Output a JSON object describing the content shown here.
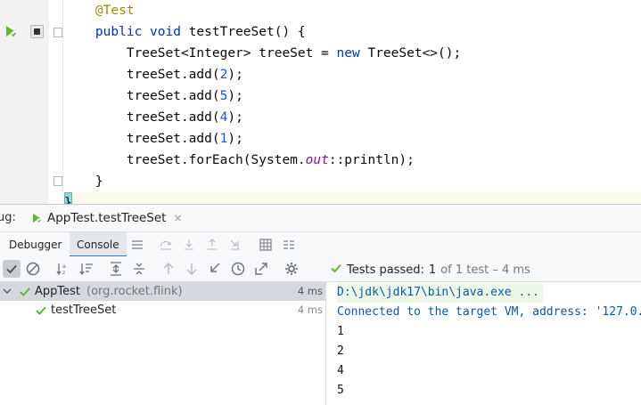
{
  "editor": {
    "lines": [
      {
        "ind": "    ",
        "segs": [
          {
            "t": "@Test",
            "c": "ann"
          }
        ]
      },
      {
        "ind": "    ",
        "segs": [
          {
            "t": "public ",
            "c": "kw"
          },
          {
            "t": "void ",
            "c": "kw"
          },
          {
            "t": "testTreeSet() {",
            "c": ""
          }
        ]
      },
      {
        "ind": "        ",
        "segs": [
          {
            "t": "TreeSet<Integer> treeSet = ",
            "c": ""
          },
          {
            "t": "new ",
            "c": "kw"
          },
          {
            "t": "TreeSet<>();",
            "c": ""
          }
        ]
      },
      {
        "ind": "        ",
        "segs": [
          {
            "t": "treeSet.add(",
            "c": ""
          },
          {
            "t": "2",
            "c": "num"
          },
          {
            "t": ");",
            "c": ""
          }
        ]
      },
      {
        "ind": "        ",
        "segs": [
          {
            "t": "treeSet.add(",
            "c": ""
          },
          {
            "t": "5",
            "c": "num"
          },
          {
            "t": ");",
            "c": ""
          }
        ]
      },
      {
        "ind": "        ",
        "segs": [
          {
            "t": "treeSet.add(",
            "c": ""
          },
          {
            "t": "4",
            "c": "num"
          },
          {
            "t": ");",
            "c": ""
          }
        ]
      },
      {
        "ind": "        ",
        "segs": [
          {
            "t": "treeSet.add(",
            "c": ""
          },
          {
            "t": "1",
            "c": "num"
          },
          {
            "t": ");",
            "c": ""
          }
        ]
      },
      {
        "ind": "        ",
        "segs": [
          {
            "t": "treeSet.forEach(System.",
            "c": ""
          },
          {
            "t": "out",
            "c": "field"
          },
          {
            "t": "::println);",
            "c": ""
          }
        ]
      },
      {
        "ind": "    ",
        "segs": [
          {
            "t": "}",
            "c": ""
          }
        ]
      }
    ],
    "last_line_char": "}"
  },
  "debug": {
    "window_label": "ug:",
    "session_tab": "AppTest.testTreeSet",
    "close_glyph": "×",
    "tabs": {
      "debugger": "Debugger",
      "console": "Console"
    },
    "tests_passed": {
      "label": "Tests passed:",
      "count": "1",
      "suffix": "of 1 test – 4 ms"
    },
    "tree": [
      {
        "name": "AppTest",
        "pkg": "(org.rocket.flink)",
        "time": "4 ms"
      },
      {
        "name": "testTreeSet",
        "pkg": "",
        "time": "4 ms"
      }
    ],
    "console": {
      "command": "D:\\jdk\\jdk17\\bin\\java.exe ...",
      "connected": "Connected to the target VM, address: '127.0.0.1:",
      "output": [
        "1",
        "2",
        "4",
        "5"
      ]
    }
  },
  "colors": {
    "accent": "#3574f0",
    "pass_green": "#5fb832",
    "keyword": "#0033b3",
    "annotation": "#9e880d",
    "number": "#1750eb",
    "field": "#871094"
  },
  "icons": [
    "run-test-icon",
    "breakpoint-icon",
    "fold-icon",
    "checkmark-icon",
    "stop-icon",
    "sort-alpha-icon",
    "sort-duration-icon",
    "expand-all-icon",
    "collapse-all-icon",
    "previous-failed-icon",
    "next-failed-icon",
    "import-tests-icon",
    "history-icon",
    "export-icon",
    "settings-icon",
    "step-over-icon",
    "step-into-icon",
    "step-out-icon",
    "run-to-cursor-icon",
    "evaluate-icon",
    "restore-layout-icon",
    "menu-icon"
  ]
}
